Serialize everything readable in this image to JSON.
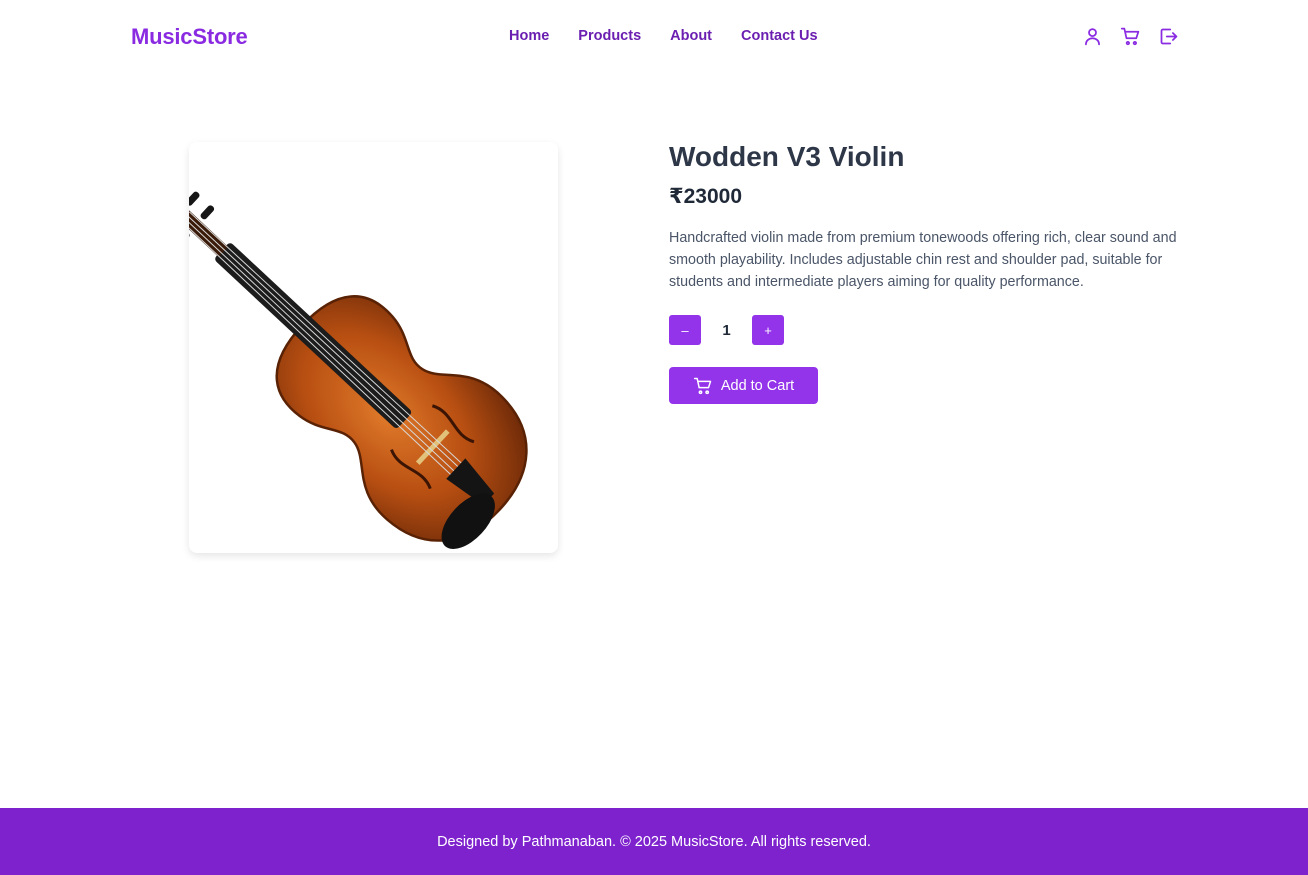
{
  "header": {
    "brand": "MusicStore",
    "nav": [
      "Home",
      "Products",
      "About",
      "Contact Us"
    ],
    "icons": [
      "user-icon",
      "cart-icon",
      "logout-icon"
    ]
  },
  "product": {
    "title": "Wodden V3 Violin",
    "price": "₹23000",
    "description": "Handcrafted violin made from premium tonewoods offering rich, clear sound and smooth playability. Includes adjustable chin rest and shoulder pad, suitable for students and intermediate players aiming for quality performance.",
    "quantity": "1",
    "decrement_label": "–",
    "increment_label": "+",
    "add_to_cart_label": "Add to Cart",
    "image_icon": "violin-image"
  },
  "footer": {
    "text": "Designed by Pathmanaban. © 2025 MusicStore. All rights reserved."
  },
  "colors": {
    "accent": "#9333ea",
    "brand": "#8a2be2",
    "footer_bg": "#7e22ce"
  }
}
